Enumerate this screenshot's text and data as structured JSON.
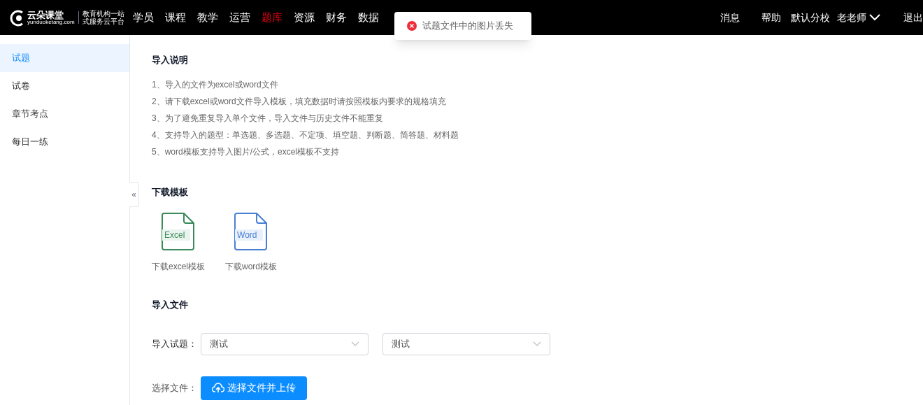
{
  "logo": {
    "name": "云朵课堂",
    "domain": "yunduoketang.com",
    "slogan_1": "教育机构一站",
    "slogan_2": "式服务云平台"
  },
  "nav": [
    {
      "label": "学员",
      "selected": false
    },
    {
      "label": "课程",
      "selected": false
    },
    {
      "label": "教学",
      "selected": false
    },
    {
      "label": "运营",
      "selected": false
    },
    {
      "label": "题库",
      "selected": true
    },
    {
      "label": "资源",
      "selected": false
    },
    {
      "label": "财务",
      "selected": false
    },
    {
      "label": "数据",
      "selected": false
    }
  ],
  "header_right": {
    "messages": "消息",
    "help": "帮助",
    "branch": "默认分校",
    "user": "老老师",
    "logout": "退出"
  },
  "toast": {
    "message": "试题文件中的图片丢失"
  },
  "sidebar": {
    "items": [
      {
        "label": "试题",
        "selected": true
      },
      {
        "label": "试卷",
        "selected": false
      },
      {
        "label": "章节考点",
        "selected": false
      },
      {
        "label": "每日一练",
        "selected": false
      }
    ],
    "collapse": "«"
  },
  "instructions": {
    "title": "导入说明",
    "lines": [
      "1、导入的文件为excel或word文件",
      "2、请下载excel或word文件导入模板，填充数据时请按照模板内要求的规格填充",
      "3、为了避免重复导入单个文件，导入文件与历史文件不能重复",
      "4、支持导入的题型：单选题、多选题、不定项、填空题、判断题、简答题、材料题",
      "5、word模板支持导入图片/公式，excel模板不支持"
    ]
  },
  "templates": {
    "title": "下载模板",
    "items": [
      {
        "kind": "excel",
        "badge": "Excel",
        "label": "下载excel模板",
        "color": "#3a8a5c"
      },
      {
        "kind": "word",
        "badge": "Word",
        "label": "下载word模板",
        "color": "#4a7fd4"
      }
    ]
  },
  "import": {
    "title": "导入文件",
    "questions_label": "导入试题：",
    "selects": [
      {
        "value": "测试"
      },
      {
        "value": "测试"
      }
    ],
    "file_label": "选择文件：",
    "upload_button": "选择文件并上传"
  }
}
